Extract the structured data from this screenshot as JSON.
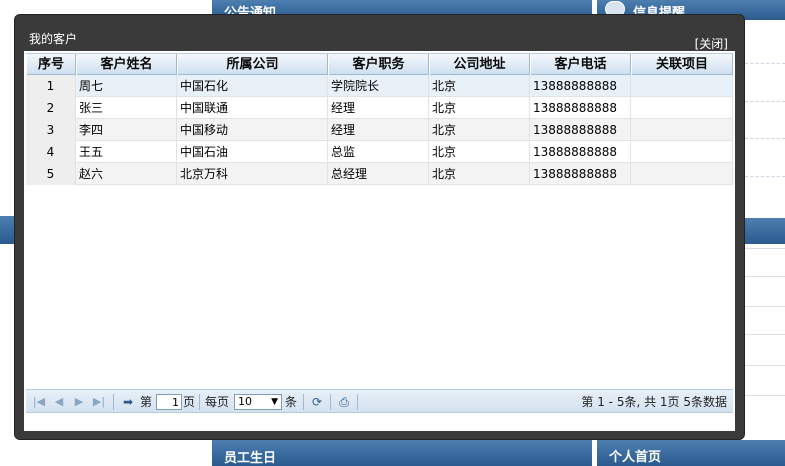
{
  "background": {
    "top_left_bar": "公告通知",
    "top_right_bar": "信息提醒",
    "bottom_left_bar": "员工生日",
    "bottom_right_bar": "个人首页"
  },
  "dialog": {
    "title": "我的客户",
    "close_label": "[关闭]"
  },
  "grid": {
    "columns": [
      "序号",
      "客户姓名",
      "所属公司",
      "客户职务",
      "公司地址",
      "客户电话",
      "关联项目"
    ],
    "rows": [
      [
        "1",
        "周七",
        "中国石化",
        "学院院长",
        "北京",
        "13888888888",
        ""
      ],
      [
        "2",
        "张三",
        "中国联通",
        "经理",
        "北京",
        "13888888888",
        ""
      ],
      [
        "3",
        "李四",
        "中国移动",
        "经理",
        "北京",
        "13888888888",
        ""
      ],
      [
        "4",
        "王五",
        "中国石油",
        "总监",
        "北京",
        "13888888888",
        ""
      ],
      [
        "5",
        "赵六",
        "北京万科",
        "总经理",
        "北京",
        "13888888888",
        ""
      ]
    ]
  },
  "pager": {
    "page_prefix": "第",
    "page_value": "1",
    "page_suffix": "页",
    "per_page_prefix": "每页",
    "per_page_value": "10",
    "per_page_suffix": "条",
    "info": "第 1 - 5条, 共 1页 5条数据"
  }
}
